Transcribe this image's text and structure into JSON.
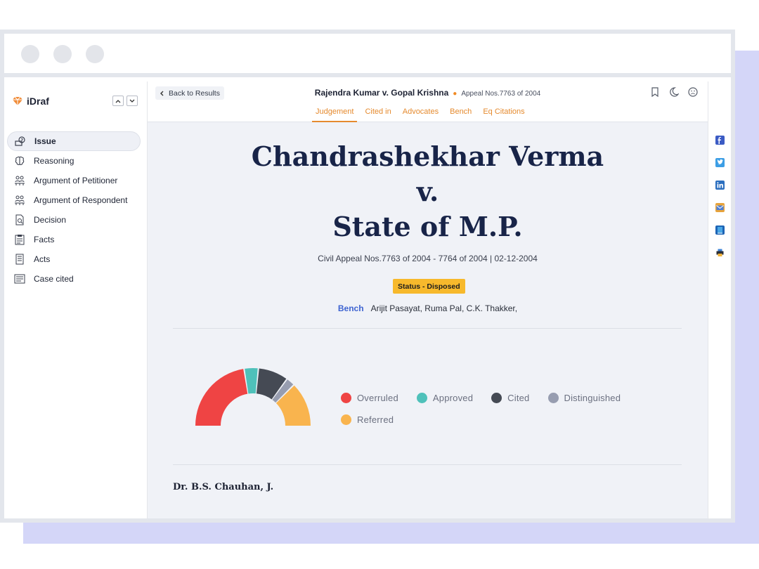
{
  "window": {
    "traffic_lights": [
      "dot",
      "dot",
      "dot"
    ]
  },
  "sidebar": {
    "brand": "iDraf",
    "items": [
      {
        "label": "Issue",
        "icon": "issue-icon",
        "active": true
      },
      {
        "label": "Reasoning",
        "icon": "brain-icon",
        "active": false
      },
      {
        "label": "Argument of Petitioner",
        "icon": "people-icon",
        "active": false
      },
      {
        "label": "Argument of Respondent",
        "icon": "people-icon",
        "active": false
      },
      {
        "label": "Decision",
        "icon": "document-search-icon",
        "active": false
      },
      {
        "label": "Facts",
        "icon": "clipboard-icon",
        "active": false
      },
      {
        "label": "Acts",
        "icon": "book-icon",
        "active": false
      },
      {
        "label": "Case cited",
        "icon": "list-icon",
        "active": false
      }
    ]
  },
  "header": {
    "back_label": "Back to Results",
    "case_name": "Rajendra Kumar v. Gopal Krishna",
    "appeal": "Appeal Nos.7763 of 2004",
    "tabs": [
      "Judgement",
      "Cited in",
      "Advocates",
      "Bench",
      "Eq Citations"
    ],
    "active_tab": "Judgement"
  },
  "document": {
    "title_line1": "Chandrashekhar Verma",
    "title_line2": "v.",
    "title_line3": "State of M.P.",
    "citation": "Civil Appeal Nos.7763 of 2004 - 7764 of 2004 | 02-12-2004",
    "status": "Status - Disposed",
    "bench_label": "Bench",
    "bench_names": "Arijit Pasayat, Ruma Pal, C.K. Thakker,",
    "judge": "Dr. B.S. Chauhan, J."
  },
  "chart_data": {
    "type": "pie",
    "style": "half-donut",
    "categories": [
      "Overruled",
      "Approved",
      "Cited",
      "Distinguished",
      "Referred"
    ],
    "values": [
      45,
      8,
      17,
      5,
      25
    ],
    "colors": [
      "#ef4444",
      "#4fc1ba",
      "#454a54",
      "#979db0",
      "#f9b44e"
    ],
    "legend_position": "right"
  },
  "share": {
    "items": [
      "facebook-icon",
      "twitter-icon",
      "linkedin-icon",
      "email-icon",
      "bookmark-book-icon",
      "print-icon"
    ]
  }
}
